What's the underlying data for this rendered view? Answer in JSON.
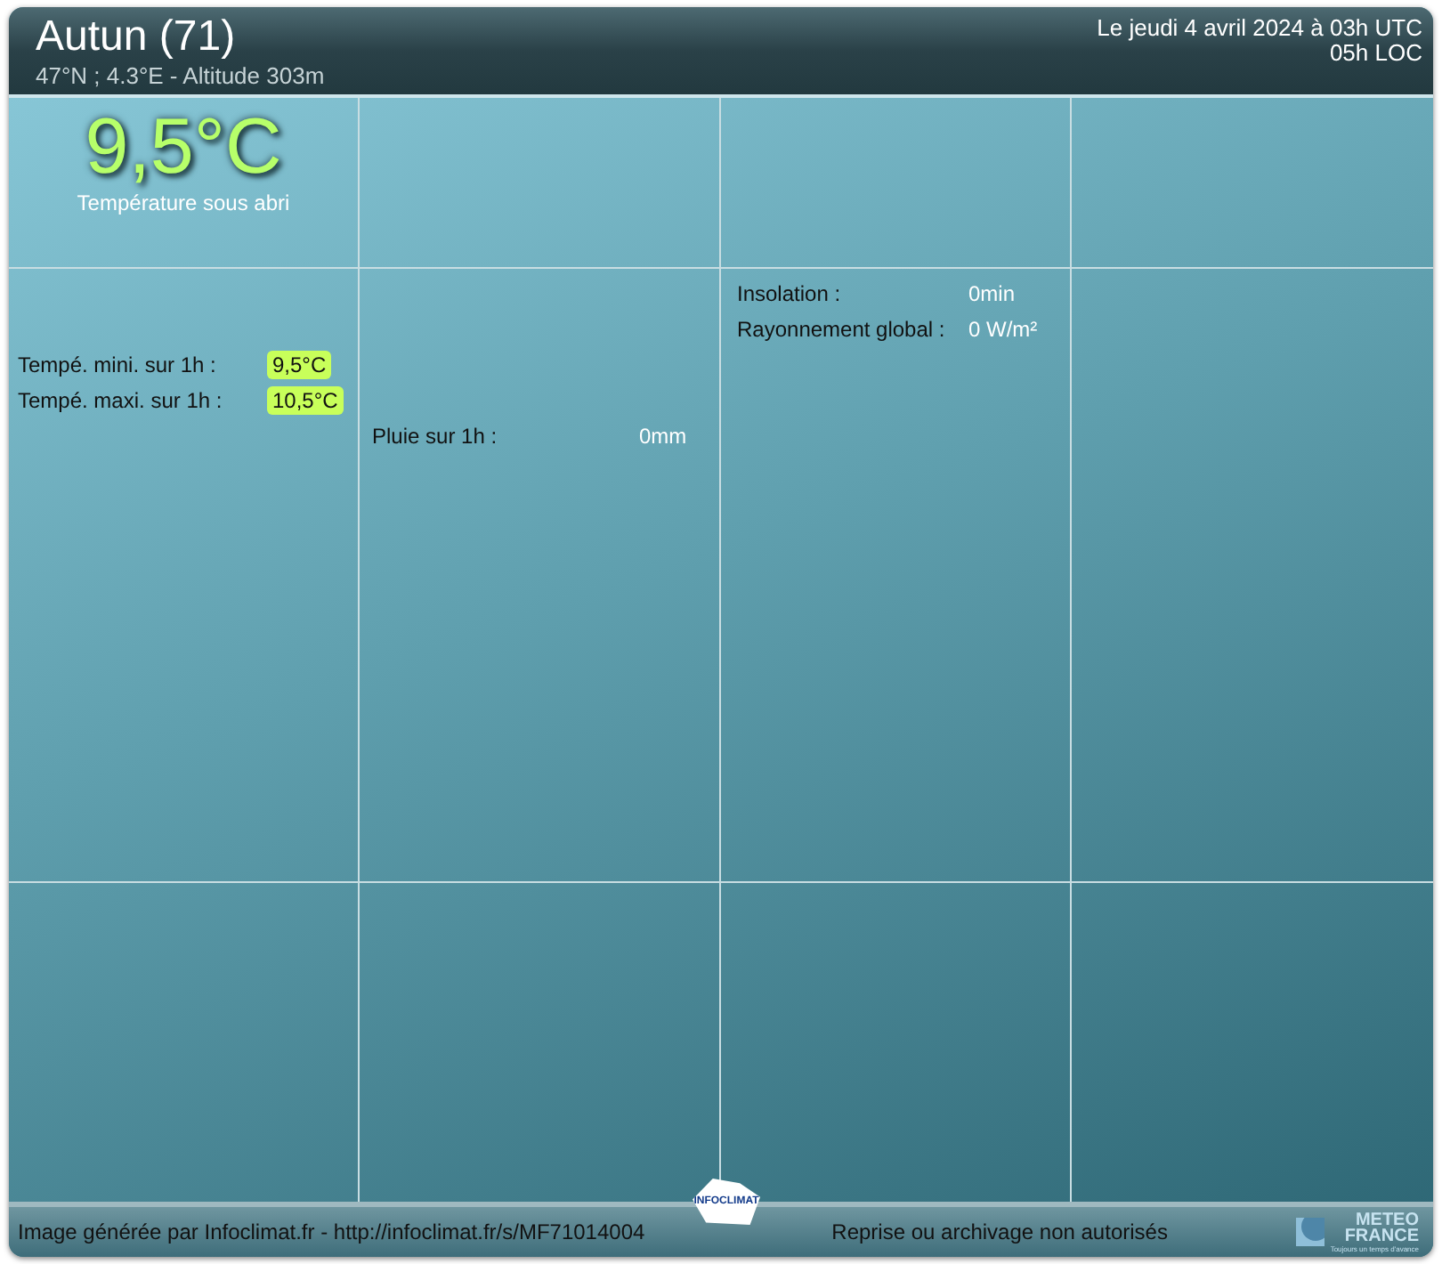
{
  "header": {
    "title": "Autun (71)",
    "subtitle": "47°N ; 4.3°E - Altitude 303m",
    "date": "Le jeudi 4 avril 2024 à 03h UTC",
    "local_time": "05h LOC"
  },
  "main_temperature": {
    "value": "9,5°C",
    "label": "Température sous abri"
  },
  "temperature_extremes": [
    {
      "label": "Tempé. mini. sur 1h :",
      "value": "9,5°C"
    },
    {
      "label": "Tempé. maxi. sur 1h :",
      "value": "10,5°C"
    }
  ],
  "rain": {
    "label": "Pluie sur 1h :",
    "value": "0mm"
  },
  "sunshine": [
    {
      "label": "Insolation :",
      "value": "0min"
    },
    {
      "label": "Rayonnement global :",
      "value": "0 W/m²"
    }
  ],
  "footer": {
    "credit": "Image générée par Infoclimat.fr - http://infoclimat.fr/s/MF71014004",
    "notice": "Reprise ou archivage non autorisés",
    "logo_left": "INFOCLIMAT",
    "logo_right": [
      "METEO",
      "FRANCE"
    ],
    "logo_tagline": "Toujours un temps d'avance"
  }
}
